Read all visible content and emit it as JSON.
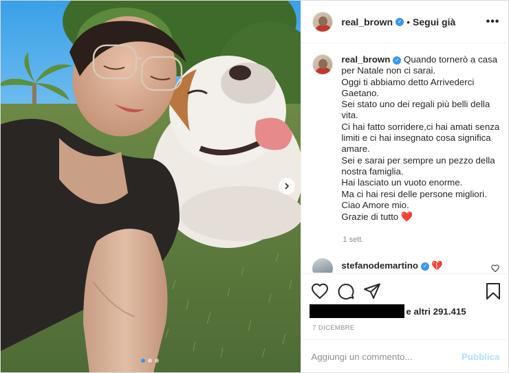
{
  "header": {
    "username": "real_brown",
    "separator": "•",
    "follow_label": "Segui già",
    "more_label": "•••"
  },
  "caption": {
    "username": "real_brown",
    "first_line": "Quando tornerò a casa per Natale non ci sarai.",
    "lines": [
      "Oggi ti abbiamo detto Arrivederci Gaetano.",
      "Sei stato uno dei regali più belli della vita.",
      "Ci hai fatto sorridere,ci hai amati senza limiti e ci hai insegnato cosa significa amare.",
      "Sei e sarai per sempre un pezzo della nostra famiglia.",
      "Hai lasciato un vuoto enorme.",
      "Ma ci hai resi delle persone migliori.",
      "Ciao Amore mio.",
      "Grazie di tutto"
    ],
    "emoji": "❤️",
    "time": "1 sett."
  },
  "comment": {
    "username": "stefanodemartino",
    "emoji": "💔"
  },
  "likes": {
    "text": "e altri 291.415"
  },
  "date": "7 DICEMBRE",
  "add_comment": {
    "placeholder": "Aggiungi un commento...",
    "publish_label": "Pubblica"
  },
  "carousel": {
    "slides": 3,
    "active": 1
  },
  "colors": {
    "verified": "#3897f0",
    "heart": "#ed4956",
    "publish_disabled": "#b2dffc",
    "muted": "#8e8e8e"
  }
}
